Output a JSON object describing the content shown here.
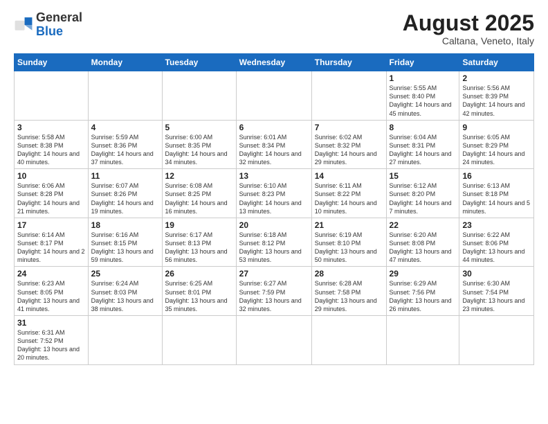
{
  "logo": {
    "text_general": "General",
    "text_blue": "Blue"
  },
  "header": {
    "month": "August 2025",
    "location": "Caltana, Veneto, Italy"
  },
  "days_of_week": [
    "Sunday",
    "Monday",
    "Tuesday",
    "Wednesday",
    "Thursday",
    "Friday",
    "Saturday"
  ],
  "weeks": [
    [
      {
        "day": "",
        "info": ""
      },
      {
        "day": "",
        "info": ""
      },
      {
        "day": "",
        "info": ""
      },
      {
        "day": "",
        "info": ""
      },
      {
        "day": "",
        "info": ""
      },
      {
        "day": "1",
        "info": "Sunrise: 5:55 AM\nSunset: 8:40 PM\nDaylight: 14 hours and 45 minutes."
      },
      {
        "day": "2",
        "info": "Sunrise: 5:56 AM\nSunset: 8:39 PM\nDaylight: 14 hours and 42 minutes."
      }
    ],
    [
      {
        "day": "3",
        "info": "Sunrise: 5:58 AM\nSunset: 8:38 PM\nDaylight: 14 hours and 40 minutes."
      },
      {
        "day": "4",
        "info": "Sunrise: 5:59 AM\nSunset: 8:36 PM\nDaylight: 14 hours and 37 minutes."
      },
      {
        "day": "5",
        "info": "Sunrise: 6:00 AM\nSunset: 8:35 PM\nDaylight: 14 hours and 34 minutes."
      },
      {
        "day": "6",
        "info": "Sunrise: 6:01 AM\nSunset: 8:34 PM\nDaylight: 14 hours and 32 minutes."
      },
      {
        "day": "7",
        "info": "Sunrise: 6:02 AM\nSunset: 8:32 PM\nDaylight: 14 hours and 29 minutes."
      },
      {
        "day": "8",
        "info": "Sunrise: 6:04 AM\nSunset: 8:31 PM\nDaylight: 14 hours and 27 minutes."
      },
      {
        "day": "9",
        "info": "Sunrise: 6:05 AM\nSunset: 8:29 PM\nDaylight: 14 hours and 24 minutes."
      }
    ],
    [
      {
        "day": "10",
        "info": "Sunrise: 6:06 AM\nSunset: 8:28 PM\nDaylight: 14 hours and 21 minutes."
      },
      {
        "day": "11",
        "info": "Sunrise: 6:07 AM\nSunset: 8:26 PM\nDaylight: 14 hours and 19 minutes."
      },
      {
        "day": "12",
        "info": "Sunrise: 6:08 AM\nSunset: 8:25 PM\nDaylight: 14 hours and 16 minutes."
      },
      {
        "day": "13",
        "info": "Sunrise: 6:10 AM\nSunset: 8:23 PM\nDaylight: 14 hours and 13 minutes."
      },
      {
        "day": "14",
        "info": "Sunrise: 6:11 AM\nSunset: 8:22 PM\nDaylight: 14 hours and 10 minutes."
      },
      {
        "day": "15",
        "info": "Sunrise: 6:12 AM\nSunset: 8:20 PM\nDaylight: 14 hours and 7 minutes."
      },
      {
        "day": "16",
        "info": "Sunrise: 6:13 AM\nSunset: 8:18 PM\nDaylight: 14 hours and 5 minutes."
      }
    ],
    [
      {
        "day": "17",
        "info": "Sunrise: 6:14 AM\nSunset: 8:17 PM\nDaylight: 14 hours and 2 minutes."
      },
      {
        "day": "18",
        "info": "Sunrise: 6:16 AM\nSunset: 8:15 PM\nDaylight: 13 hours and 59 minutes."
      },
      {
        "day": "19",
        "info": "Sunrise: 6:17 AM\nSunset: 8:13 PM\nDaylight: 13 hours and 56 minutes."
      },
      {
        "day": "20",
        "info": "Sunrise: 6:18 AM\nSunset: 8:12 PM\nDaylight: 13 hours and 53 minutes."
      },
      {
        "day": "21",
        "info": "Sunrise: 6:19 AM\nSunset: 8:10 PM\nDaylight: 13 hours and 50 minutes."
      },
      {
        "day": "22",
        "info": "Sunrise: 6:20 AM\nSunset: 8:08 PM\nDaylight: 13 hours and 47 minutes."
      },
      {
        "day": "23",
        "info": "Sunrise: 6:22 AM\nSunset: 8:06 PM\nDaylight: 13 hours and 44 minutes."
      }
    ],
    [
      {
        "day": "24",
        "info": "Sunrise: 6:23 AM\nSunset: 8:05 PM\nDaylight: 13 hours and 41 minutes."
      },
      {
        "day": "25",
        "info": "Sunrise: 6:24 AM\nSunset: 8:03 PM\nDaylight: 13 hours and 38 minutes."
      },
      {
        "day": "26",
        "info": "Sunrise: 6:25 AM\nSunset: 8:01 PM\nDaylight: 13 hours and 35 minutes."
      },
      {
        "day": "27",
        "info": "Sunrise: 6:27 AM\nSunset: 7:59 PM\nDaylight: 13 hours and 32 minutes."
      },
      {
        "day": "28",
        "info": "Sunrise: 6:28 AM\nSunset: 7:58 PM\nDaylight: 13 hours and 29 minutes."
      },
      {
        "day": "29",
        "info": "Sunrise: 6:29 AM\nSunset: 7:56 PM\nDaylight: 13 hours and 26 minutes."
      },
      {
        "day": "30",
        "info": "Sunrise: 6:30 AM\nSunset: 7:54 PM\nDaylight: 13 hours and 23 minutes."
      }
    ],
    [
      {
        "day": "31",
        "info": "Sunrise: 6:31 AM\nSunset: 7:52 PM\nDaylight: 13 hours and 20 minutes."
      },
      {
        "day": "",
        "info": ""
      },
      {
        "day": "",
        "info": ""
      },
      {
        "day": "",
        "info": ""
      },
      {
        "day": "",
        "info": ""
      },
      {
        "day": "",
        "info": ""
      },
      {
        "day": "",
        "info": ""
      }
    ]
  ]
}
